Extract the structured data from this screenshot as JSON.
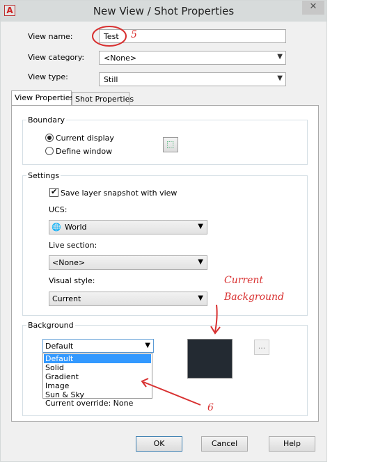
{
  "window": {
    "title": "New View / Shot Properties",
    "close_glyph": "✕",
    "app_icon_letter": "A"
  },
  "fields": {
    "view_name_label": "View name:",
    "view_name_value": "Test",
    "view_category_label": "View category:",
    "view_category_value": "<None>",
    "view_type_label": "View type:",
    "view_type_value": "Still"
  },
  "tabs": [
    {
      "label": "View Properties",
      "active": true
    },
    {
      "label": "Shot Properties",
      "active": false
    }
  ],
  "boundary": {
    "title": "Boundary",
    "current_display": "Current display",
    "define_window": "Define window"
  },
  "settings": {
    "title": "Settings",
    "save_layer_snapshot": "Save layer snapshot with view",
    "ucs_label": "UCS:",
    "ucs_value": "World",
    "live_section_label": "Live section:",
    "live_section_value": "<None>",
    "visual_style_label": "Visual style:",
    "visual_style_value": "Current"
  },
  "background": {
    "title": "Background",
    "selected": "Default",
    "options": [
      "Default",
      "Solid",
      "Gradient",
      "Image",
      "Sun & Sky"
    ],
    "current_override": "Current override: None",
    "ellipsis": "...",
    "preview_color": "#232a32"
  },
  "buttons": {
    "ok": "OK",
    "cancel": "Cancel",
    "help": "Help"
  },
  "annotations": {
    "step5": "5",
    "step6": "6",
    "current_background_line1": "Current",
    "current_background_line2": "Background",
    "color": "#d83030"
  }
}
